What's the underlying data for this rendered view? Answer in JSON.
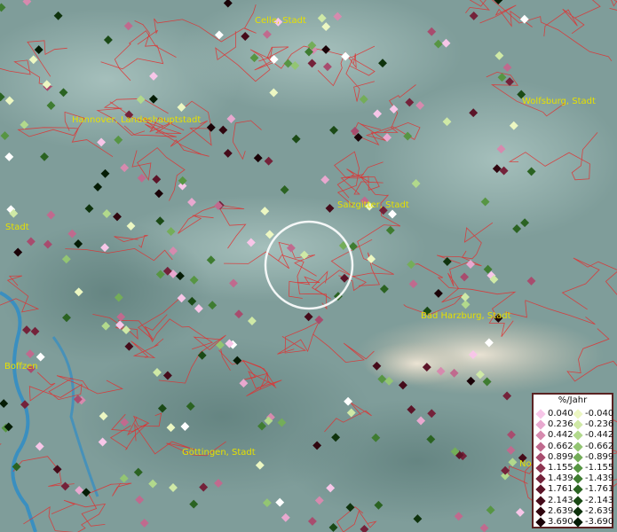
{
  "map": {
    "cities": [
      {
        "label": "Celle, Stadt"
      },
      {
        "label": "Wolfsburg, Stadt"
      },
      {
        "label": "Hannover, Landeshauptstadt"
      },
      {
        "label": "Salzgitter, Stadt"
      },
      {
        "label": "Stadt"
      },
      {
        "label": "Bad Harzburg, Stadt"
      },
      {
        "label": "Boffzen"
      },
      {
        "label": "Göttingen, Stadt"
      },
      {
        "label": "No"
      }
    ],
    "colors": {
      "border": "#e03030",
      "city_label": "#e6e000",
      "river": "#3a8fc0",
      "highlight_circle": "#ffffff"
    }
  },
  "legend": {
    "title": "%/Jahr",
    "positive": [
      {
        "value": "0.040",
        "color": "#f7c6e8"
      },
      {
        "value": "0.236",
        "color": "#e8a8cf"
      },
      {
        "value": "0.442",
        "color": "#d68aae"
      },
      {
        "value": "0.662",
        "color": "#c06a8e"
      },
      {
        "value": "0.899",
        "color": "#a84c6e"
      },
      {
        "value": "1.155",
        "color": "#8e3551"
      },
      {
        "value": "1.439",
        "color": "#74223a"
      },
      {
        "value": "1.761",
        "color": "#5c1428"
      },
      {
        "value": "2.143",
        "color": "#450b1a"
      },
      {
        "value": "2.639",
        "color": "#30060f"
      },
      {
        "value": "3.690",
        "color": "#1a0207"
      }
    ],
    "negative": [
      {
        "value": "-0.040",
        "color": "#ecf7c2"
      },
      {
        "value": "-0.236",
        "color": "#cfe9a6"
      },
      {
        "value": "-0.442",
        "color": "#b2d98c"
      },
      {
        "value": "-0.662",
        "color": "#93c573"
      },
      {
        "value": "-0.899",
        "color": "#74ad59"
      },
      {
        "value": "-1.155",
        "color": "#579543"
      },
      {
        "value": "-1.439",
        "color": "#3f7c31"
      },
      {
        "value": "-1.761",
        "color": "#2b6322"
      },
      {
        "value": "-2.143",
        "color": "#1b4a16"
      },
      {
        "value": "-2.639",
        "color": "#0f330d"
      },
      {
        "value": "-3.690",
        "color": "#051c05"
      }
    ]
  }
}
